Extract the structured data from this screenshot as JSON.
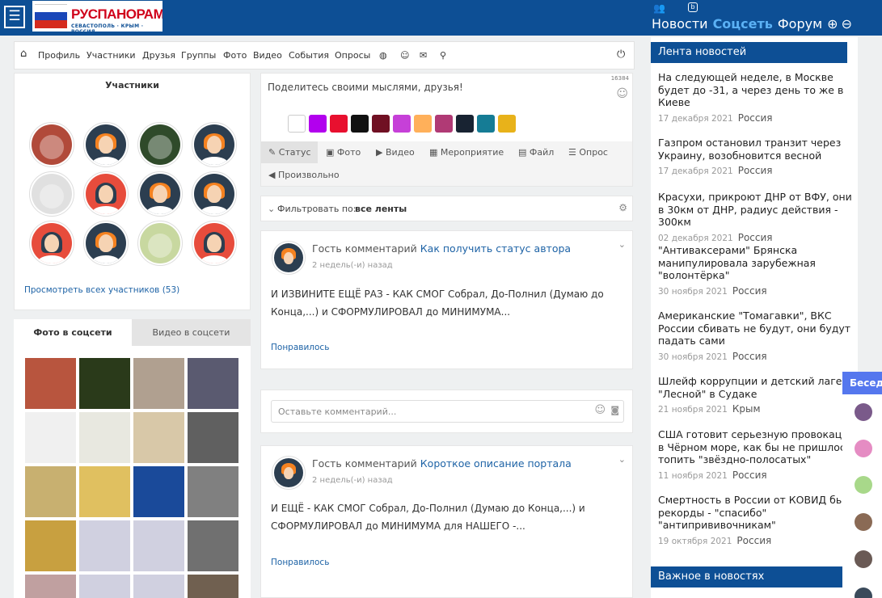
{
  "header": {
    "logo_title": "РУСПАНОРАМА",
    "logo_subtitle": "СЕВАСТОПОЛЬ · КРЫМ · РОССИЯ",
    "nav": [
      "Новости",
      "Соцсеть",
      "Форум"
    ],
    "active_nav": "Соцсеть"
  },
  "subnav": {
    "items": [
      "Профиль",
      "Участники",
      "Друзья",
      "Группы",
      "Фото",
      "Видео",
      "События",
      "Опросы"
    ]
  },
  "members": {
    "title": "Участники",
    "view_all": "Просмотреть всех участников",
    "count": "(53)"
  },
  "media_tabs": {
    "photos": "Фото в соцсети",
    "videos": "Видео в соцсети"
  },
  "composer": {
    "placeholder": "Поделитесь своими мыслями, друзья!",
    "char_count": "16384",
    "tabs": [
      "Статус",
      "Фото",
      "Видео",
      "Мероприятие",
      "Файл",
      "Опрос",
      "Произвольно"
    ],
    "swatch_colors": [
      "#ffffff",
      "#b200ee",
      "#e8102f",
      "#111111",
      "#701023",
      "#c640d8",
      "#ffb05a",
      "#b03a75",
      "#182332",
      "#157c95",
      "#e8b21a"
    ]
  },
  "filter": {
    "label": "Фильтровать по:",
    "value": "все ленты"
  },
  "posts": [
    {
      "author": "Гость комментарий",
      "link": "Как получить статус автора",
      "time": "2 недель(-и) назад",
      "text": "И ИЗВИНИТЕ ЕЩЁ РАЗ - КАК СМОГ Собрал, До-Полнил (Думаю до Конца,...) и СФОРМУЛИРОВАЛ до МИНИМУМА...",
      "like": "Понравилось"
    },
    {
      "author": "Гость комментарий",
      "link": "Короткое описание портала",
      "time": "2 недель(-и) назад",
      "text": "И ЕЩЁ - КАК СМОГ Собрал, До-Полнил (Думаю до Конца,...) и СФОРМУЛИРОВАЛ до МИНИМУМА для НАШЕГО -...",
      "like": "Понравилось"
    }
  ],
  "comment": {
    "placeholder": "Оставьте комментарий..."
  },
  "sidebar": {
    "news_title": "Лента новостей",
    "news": [
      {
        "title": "На следующей неделе, в Москве будет до -31, а через день то же в Киеве",
        "date": "17 декабря 2021",
        "tag": "Россия"
      },
      {
        "title": "Газпром остановил транзит через Украину, возобновится весной",
        "date": "17 декабря 2021",
        "tag": "Россия"
      },
      {
        "title": "Красухи, прикроют ДНР от ВФУ, они в 30км от ДНР, радиус действия - 300км",
        "date": "02 декабря 2021",
        "tag": "Россия"
      },
      {
        "title": "\"Антиваксерами\" Брянска манипулировала зарубежная \"волонтёрка\"",
        "date": "30 ноября 2021",
        "tag": "Россия"
      },
      {
        "title": "Американские \"Томагавки\", ВКС России сбивать не будут, они будут падать сами",
        "date": "30 ноября 2021",
        "tag": "Россия"
      },
      {
        "title": "Шлейф коррупции и детский лагерь \"Лесной\" в Судаке",
        "date": "21 ноября 2021",
        "tag": "Крым"
      },
      {
        "title": "США готовит серьезную провокацию в Чёрном море, как бы не пришлось топить \"звёздно-полосатых\"",
        "date": "11 ноября 2021",
        "tag": "Россия"
      },
      {
        "title": "Смертность в России от КОВИД бьёт рекорды - \"спасибо\" \"антипрививочникам\"",
        "date": "19 октября 2021",
        "tag": "Россия"
      }
    ],
    "important_title": "Важное в новостях"
  },
  "chat": {
    "label": "Беседы"
  }
}
